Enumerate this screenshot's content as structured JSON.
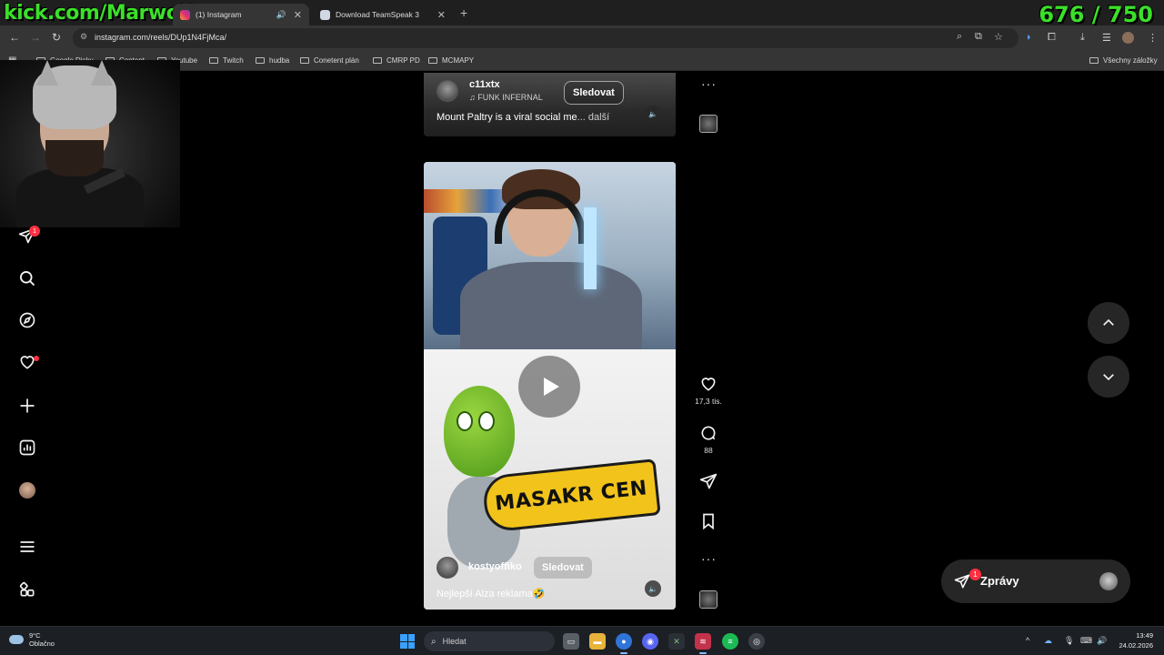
{
  "overlay": {
    "channel": "kick.com/MarwoX",
    "counter": "676 / 750"
  },
  "browser": {
    "tabs": [
      {
        "label": "(1) Instagram",
        "active": true
      },
      {
        "label": "Download TeamSpeak 3",
        "active": false
      }
    ],
    "new_tab": "+",
    "url": "instagram.com/reels/DUp1N4FjMca/",
    "bookmarks": [
      "Google Disky",
      "Content",
      "Youtube",
      "Twitch",
      "hudba",
      "Conetent plán",
      "CMRP PD",
      "MCMAPY"
    ],
    "all_bookmarks": "Všechny záložky"
  },
  "sidebar": {
    "notifications_badge": "1",
    "items": [
      "direct-icon",
      "search-icon",
      "explore-icon",
      "heart-icon",
      "create-icon",
      "dashboard-icon",
      "profile-avatar",
      "menu-icon",
      "more-apps-icon"
    ]
  },
  "reel_top": {
    "username": "c11xtx",
    "audio": "FUNK INFERNAL",
    "follow": "Sledovat",
    "caption": "Mount Paltry is a viral social me",
    "more": "... další"
  },
  "reel_main": {
    "artwork_text": "MASAKR CEN",
    "username": "kostyoffiko",
    "follow": "Sledovat",
    "caption": "Nejlepší Alza reklama🤣",
    "likes": "17,3 tis.",
    "comments": "88"
  },
  "messages": {
    "label": "Zprávy",
    "badge": "1"
  },
  "taskbar": {
    "temperature": "9°C",
    "weather": "Oblačno",
    "search_placeholder": "Hledat",
    "time": "13:49",
    "date": "24.02.2026"
  },
  "colors": {
    "overlay_green": "#3be02a",
    "notification_red": "#ff3040",
    "saw_yellow": "#f2c31b"
  }
}
